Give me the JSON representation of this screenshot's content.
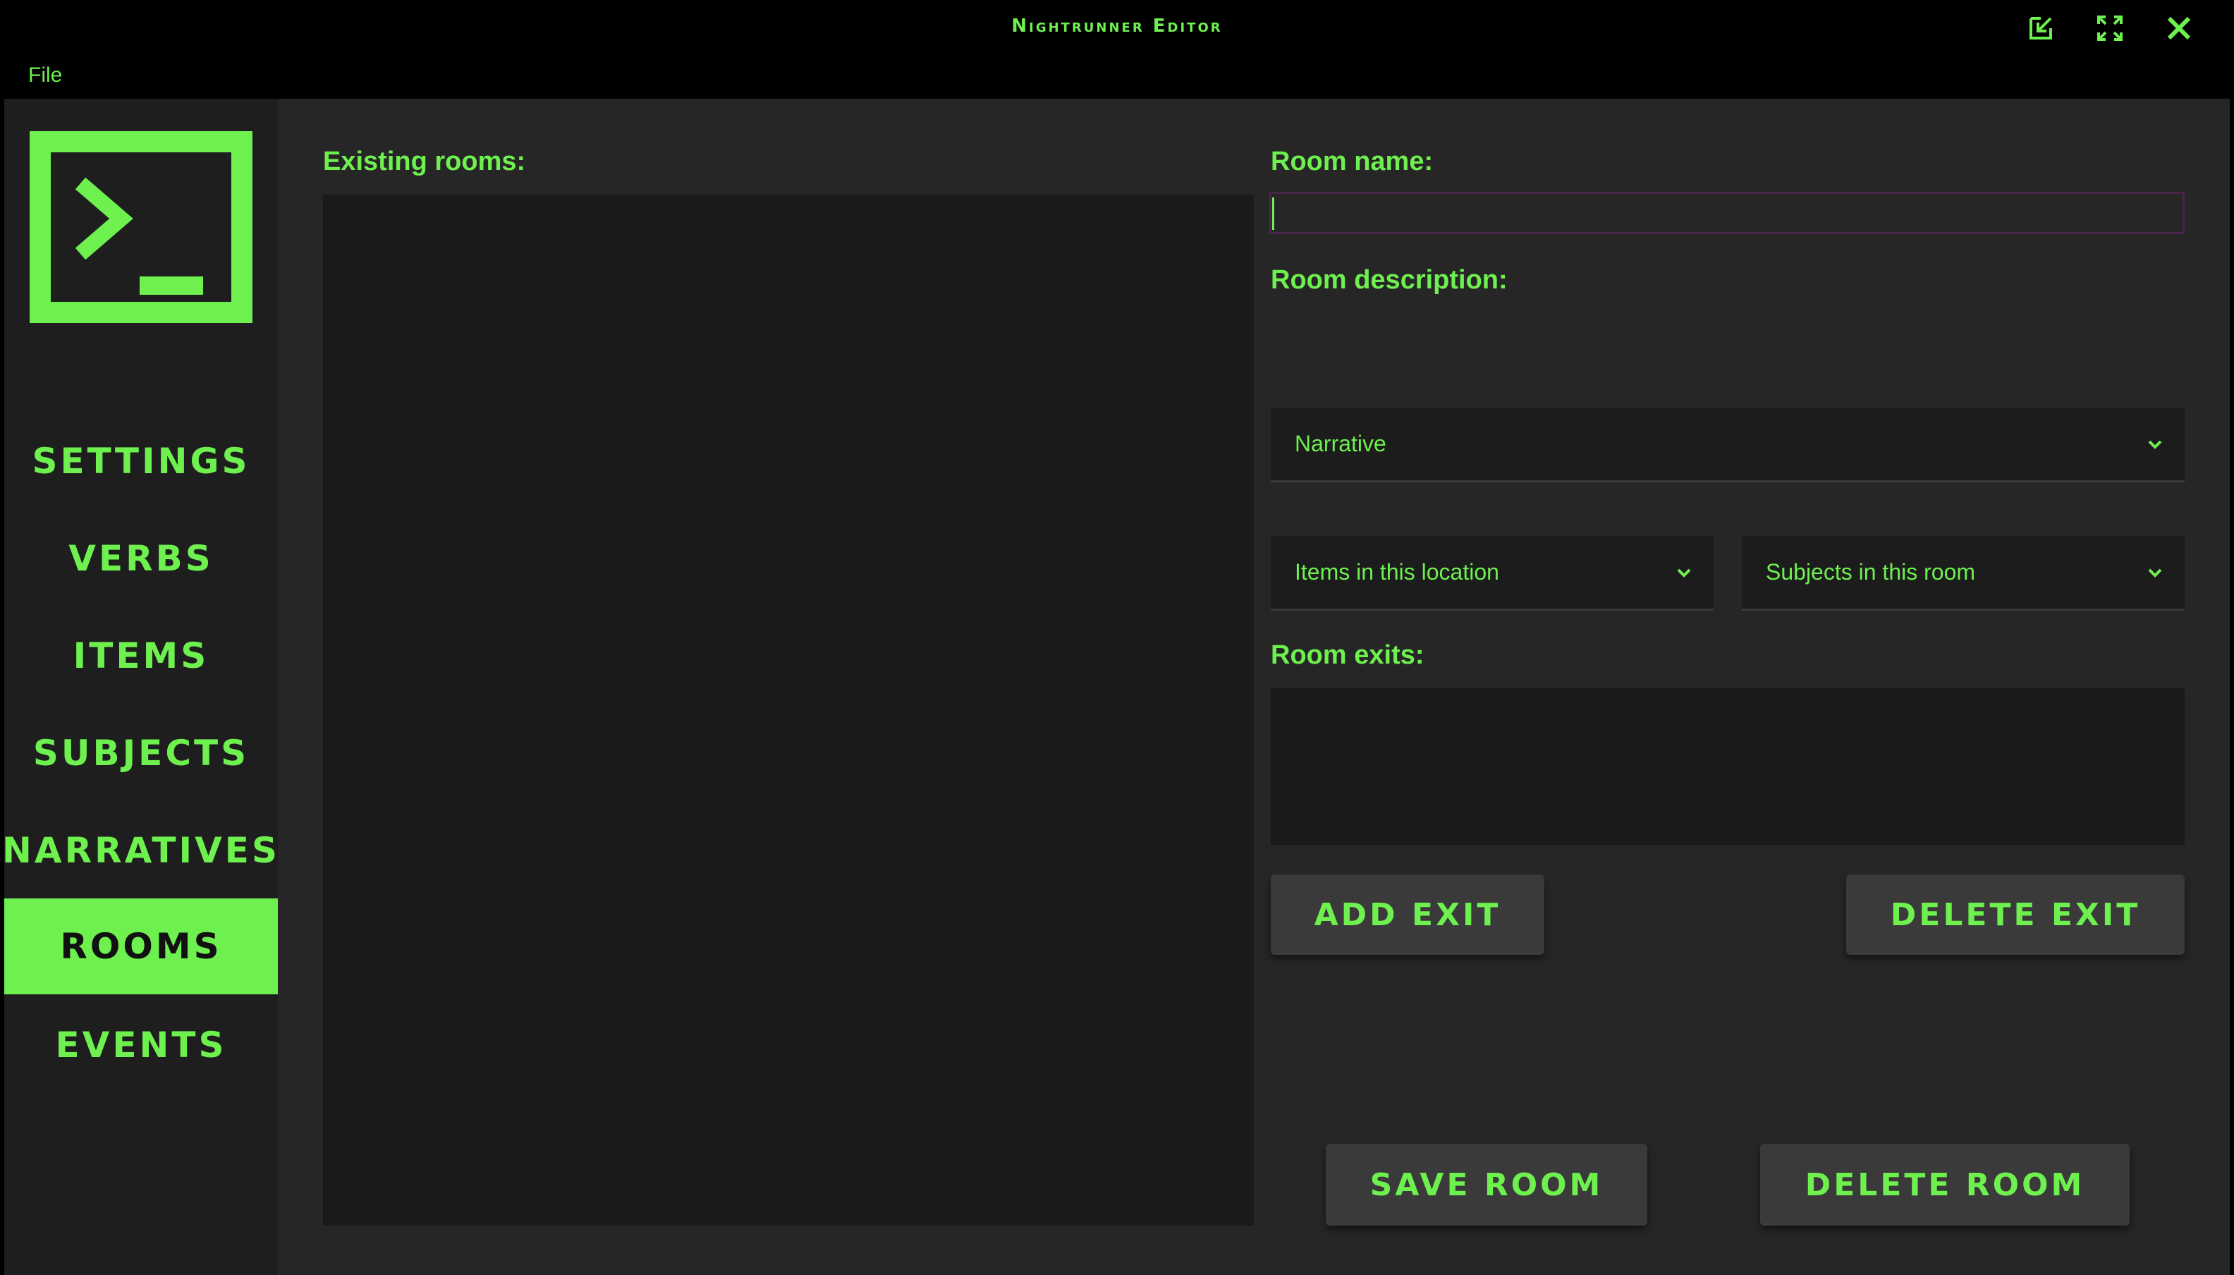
{
  "window": {
    "title": "Nightrunner Editor"
  },
  "menu": {
    "file": "File"
  },
  "sidebar": {
    "items": [
      {
        "label": "SETTINGS"
      },
      {
        "label": "VERBS"
      },
      {
        "label": "ITEMS"
      },
      {
        "label": "SUBJECTS"
      },
      {
        "label": "NARRATIVES"
      },
      {
        "label": "ROOMS",
        "active": true
      },
      {
        "label": "EVENTS"
      }
    ]
  },
  "rooms": {
    "existing_label": "Existing rooms:",
    "name_label": "Room name:",
    "name_value": "",
    "description_label": "Room description:",
    "narrative_select": "Narrative",
    "items_select": "Items in this location",
    "subjects_select": "Subjects in this room",
    "exits_label": "Room exits:",
    "add_exit": "ADD EXIT",
    "delete_exit": "DELETE EXIT",
    "save_room": "SAVE ROOM",
    "delete_room": "DELETE ROOM"
  },
  "colors": {
    "accent": "#6ef04f",
    "background": "#262626",
    "sidebar": "#1e1e1e"
  }
}
